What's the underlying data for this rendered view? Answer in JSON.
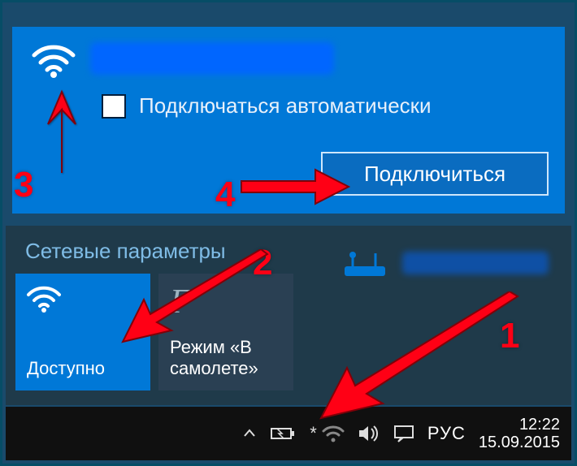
{
  "network_panel": {
    "auto_connect_label": "Подключаться автоматически",
    "connect_button": "Подключиться"
  },
  "settings": {
    "title": "Сетевые параметры",
    "tiles": {
      "wifi": {
        "label": "Доступно"
      },
      "airplane": {
        "label": "Режим «В самолете»"
      }
    }
  },
  "taskbar": {
    "language": "РУС",
    "time": "12:22",
    "date": "15.09.2015"
  },
  "annotations": {
    "n1": "1",
    "n2": "2",
    "n3": "3",
    "n4": "4"
  }
}
